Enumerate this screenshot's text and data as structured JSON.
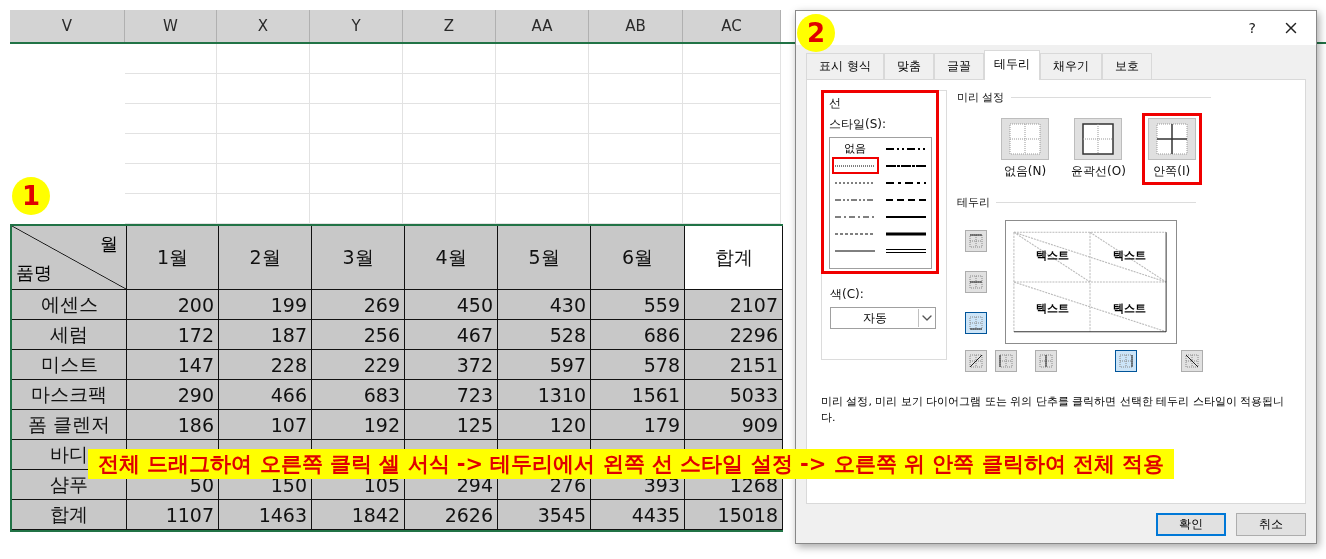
{
  "sheet": {
    "columns": [
      "V",
      "W",
      "X",
      "Y",
      "Z",
      "AA",
      "AB",
      "AC"
    ],
    "table": {
      "corner_top": "월",
      "corner_bottom": "품명",
      "headers": [
        {
          "label": "1월",
          "shaded": true
        },
        {
          "label": "2월",
          "shaded": true
        },
        {
          "label": "3월",
          "shaded": true
        },
        {
          "label": "4월",
          "shaded": true
        },
        {
          "label": "5월",
          "shaded": true
        },
        {
          "label": "6월",
          "shaded": true
        },
        {
          "label": "합계",
          "shaded": false
        }
      ],
      "rows": [
        {
          "name": "에센스",
          "values": [
            "200",
            "199",
            "269",
            "450",
            "430",
            "559",
            "2107"
          ]
        },
        {
          "name": "세럼",
          "values": [
            "172",
            "187",
            "256",
            "467",
            "528",
            "686",
            "2296"
          ]
        },
        {
          "name": "미스트",
          "values": [
            "147",
            "228",
            "229",
            "372",
            "597",
            "578",
            "2151"
          ]
        },
        {
          "name": "마스크팩",
          "values": [
            "290",
            "466",
            "683",
            "723",
            "1310",
            "1561",
            "5033"
          ]
        },
        {
          "name": "폼 클렌저",
          "values": [
            "186",
            "107",
            "192",
            "125",
            "120",
            "179",
            "909"
          ]
        },
        {
          "name": "바디",
          "values": []
        },
        {
          "name": "샴푸",
          "values": [
            "50",
            "150",
            "105",
            "294",
            "276",
            "393",
            "1268"
          ]
        },
        {
          "name": "합계",
          "values": [
            "1107",
            "1463",
            "1842",
            "2626",
            "3545",
            "4435",
            "15018"
          ]
        }
      ]
    }
  },
  "step_badges": [
    "1",
    "2"
  ],
  "banner": "전체 드래그하여 오른쪽 클릭 셀 서식 -> 테두리에서 왼쪽 선 스타일 설정 -> 오른쪽 위 안쪽 클릭하여 전체 적용",
  "dialog": {
    "help": "?",
    "tabs": [
      {
        "label": "표시 형식",
        "selected": false
      },
      {
        "label": "맞춤",
        "selected": false
      },
      {
        "label": "글꼴",
        "selected": false
      },
      {
        "label": "테두리",
        "selected": true
      },
      {
        "label": "채우기",
        "selected": false
      },
      {
        "label": "보호",
        "selected": false
      }
    ],
    "line_group": {
      "title": "선",
      "highlighted": true,
      "style_label": "스타일(S):",
      "styles": [
        {
          "kind": "none",
          "label": "없음",
          "selected": false
        },
        {
          "kind": "hair",
          "selected": true
        },
        {
          "kind": "dotted",
          "selected": false
        },
        {
          "kind": "dashdotdot",
          "selected": false
        },
        {
          "kind": "dashdot",
          "selected": false
        },
        {
          "kind": "dashed",
          "selected": false
        },
        {
          "kind": "thin",
          "selected": false
        },
        {
          "kind": "medium-dashdotdot",
          "selected": false
        },
        {
          "kind": "slant-dashdot",
          "selected": false
        },
        {
          "kind": "medium-dashdot",
          "selected": false
        },
        {
          "kind": "medium-dashed",
          "selected": false
        },
        {
          "kind": "medium",
          "selected": false
        },
        {
          "kind": "thick",
          "selected": false
        },
        {
          "kind": "double",
          "selected": false
        }
      ],
      "color_label": "색(C):",
      "color_value": "자동"
    },
    "presets_title": "미리 설정",
    "presets": [
      {
        "kind": "none",
        "label": "없음(N)",
        "highlighted": false
      },
      {
        "kind": "outline",
        "label": "윤곽선(O)",
        "highlighted": false
      },
      {
        "kind": "inside",
        "label": "안쪽(I)",
        "highlighted": true
      }
    ],
    "border_title": "테두리",
    "side_buttons": [
      {
        "kind": "top",
        "selected": false
      },
      {
        "kind": "middle",
        "selected": false
      },
      {
        "kind": "bottom",
        "selected": true
      }
    ],
    "bottom_buttons": [
      {
        "kind": "diag-up",
        "selected": false
      },
      {
        "kind": "left",
        "selected": false
      },
      {
        "kind": "center",
        "selected": false
      },
      {
        "kind": "right",
        "selected": true
      },
      {
        "kind": "diag-down",
        "selected": false
      }
    ],
    "preview_labels": [
      "텍스트",
      "텍스트",
      "텍스트",
      "텍스트"
    ],
    "note": "미리 설정, 미리 보기 다이어그램 또는 위의 단추를 클릭하면 선택한 테두리 스타일이 적용됩니다.",
    "buttons": [
      {
        "label": "확인",
        "focused": true
      },
      {
        "label": "취소",
        "focused": false
      }
    ]
  }
}
